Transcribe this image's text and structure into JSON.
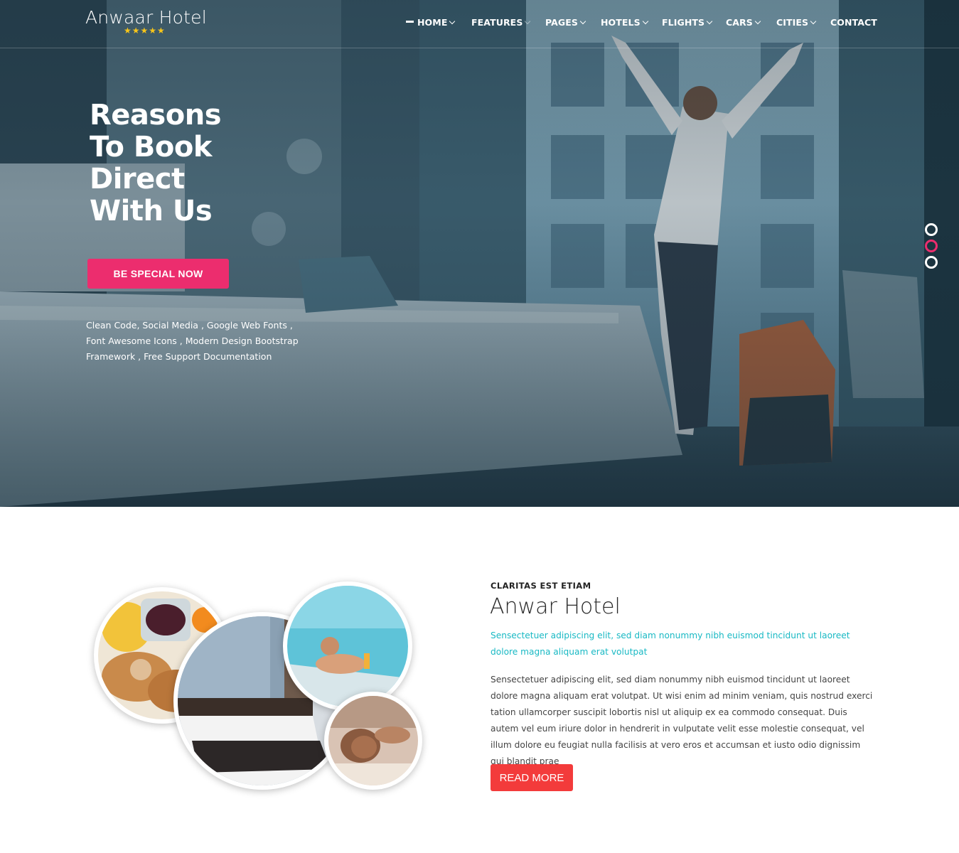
{
  "brand": {
    "name": "Anwaar Hotel",
    "stars": "★★★★★",
    "star_color": "#f7c51a"
  },
  "nav": {
    "items": [
      {
        "label": "HOME",
        "has_dropdown": true,
        "active": true
      },
      {
        "label": "FEATURES",
        "has_dropdown": true
      },
      {
        "label": "PAGES",
        "has_dropdown": true
      },
      {
        "label": "HOTELS",
        "has_dropdown": true
      },
      {
        "label": "FLIGHTS",
        "has_dropdown": true
      },
      {
        "label": "CARS",
        "has_dropdown": true
      },
      {
        "label": "CITIES",
        "has_dropdown": true
      },
      {
        "label": "CONTACT",
        "has_dropdown": false
      }
    ]
  },
  "hero": {
    "title_lines": [
      "Reasons",
      "To Book",
      "Direct",
      "With Us"
    ],
    "cta_label": "BE SPECIAL NOW",
    "description": "Clean Code, Social Media , Google Web Fonts , Font Awesome Icons , Modern Design Bootstrap Framework , Free Support Documentation",
    "slides": 3,
    "active_slide": 2,
    "accent_color": "#ec2d6e"
  },
  "about": {
    "kicker": "CLARITAS EST ETIAM",
    "title": "Anwar Hotel",
    "lead": "Sensectetuer adipiscing elit, sed diam nonummy nibh euismod tincidunt ut laoreet dolore magna aliquam erat volutpat",
    "body": "Sensectetuer adipiscing elit, sed diam nonummy nibh euismod tincidunt ut laoreet dolore magna aliquam erat volutpat. Ut wisi enim ad minim veniam, quis nostrud exerci tation ullamcorper suscipit lobortis nisl ut aliquip ex ea commodo consequat. Duis autem vel eum iriure dolor in hendrerit in vulputate velit esse molestie consequat, vel illum dolore eu feugiat nulla facilisis at vero eros et accumsan et iusto odio dignissim qui blandit prae",
    "button_label": "READ MORE",
    "lead_color": "#19b9c4",
    "button_color": "#f33b3b",
    "images": [
      "breakfast-photo",
      "hotel-room-photo",
      "pool-photo",
      "spa-massage-photo"
    ]
  }
}
